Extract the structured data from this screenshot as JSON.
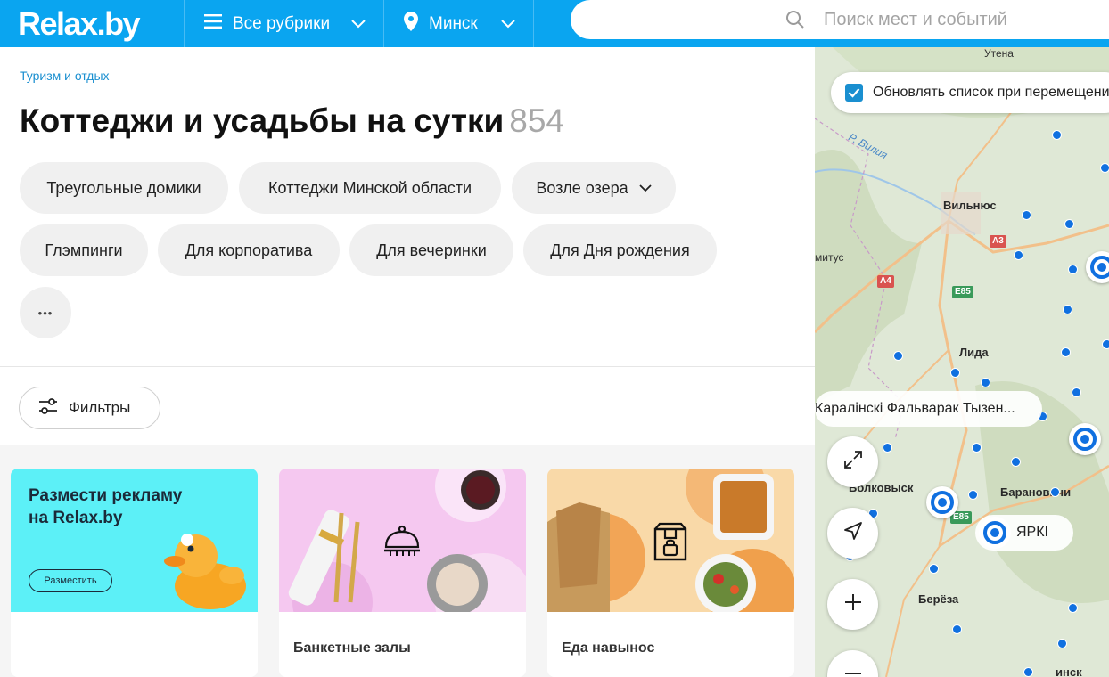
{
  "header": {
    "logo": "Relax.by",
    "rubrics_label": "Все рубрики",
    "city_label": "Минск",
    "search_placeholder": "Поиск мест и событий",
    "icons": [
      "menu-icon",
      "chevron-down-icon",
      "location-pin-icon",
      "search-icon"
    ]
  },
  "breadcrumb": "Туризм и отдых",
  "page_title": "Коттеджи и усадьбы на сутки",
  "result_count": "854",
  "chips": [
    {
      "label": "Треугольные домики"
    },
    {
      "label": "Коттеджи Минской области"
    },
    {
      "label": "Возле озера"
    },
    {
      "label": "Глэмпинги"
    },
    {
      "label": "Для корпоратива"
    },
    {
      "label": "Для вечеринки"
    },
    {
      "label": "Для Дня рождения"
    }
  ],
  "more_chip": "•••",
  "filters_label": "Фильтры",
  "cards": [
    {
      "ad_title": "Размести рекламу на Relax.by",
      "ad_button": "Разместить",
      "caption": ""
    },
    {
      "caption": "Банкетные залы"
    },
    {
      "caption": "Еда навынос"
    }
  ],
  "map": {
    "update_label": "Обновлять список при перемещении карты",
    "update_checked": true,
    "labels": {
      "utena": "Утена",
      "viliya": "Р. Вилия",
      "vilnius": "Вильнюс",
      "lida": "Лида",
      "trakai_fragment": "митус",
      "volkovysk": "Волковыск",
      "baranovichi": "Барановичи",
      "bereza": "Берёза",
      "pinsk_fragment": "инск"
    },
    "road_badges": {
      "a3": "A3",
      "a4": "A4",
      "e85_1": "E85",
      "e85_2": "E85"
    },
    "place_label_1": "Каралінскі Фальварак Тызен...",
    "place_label_2": "ЯРКІ",
    "colors": {
      "accent": "#0aa5f0",
      "pin": "#1070e0",
      "map_bg": "#dfe8d6"
    }
  }
}
